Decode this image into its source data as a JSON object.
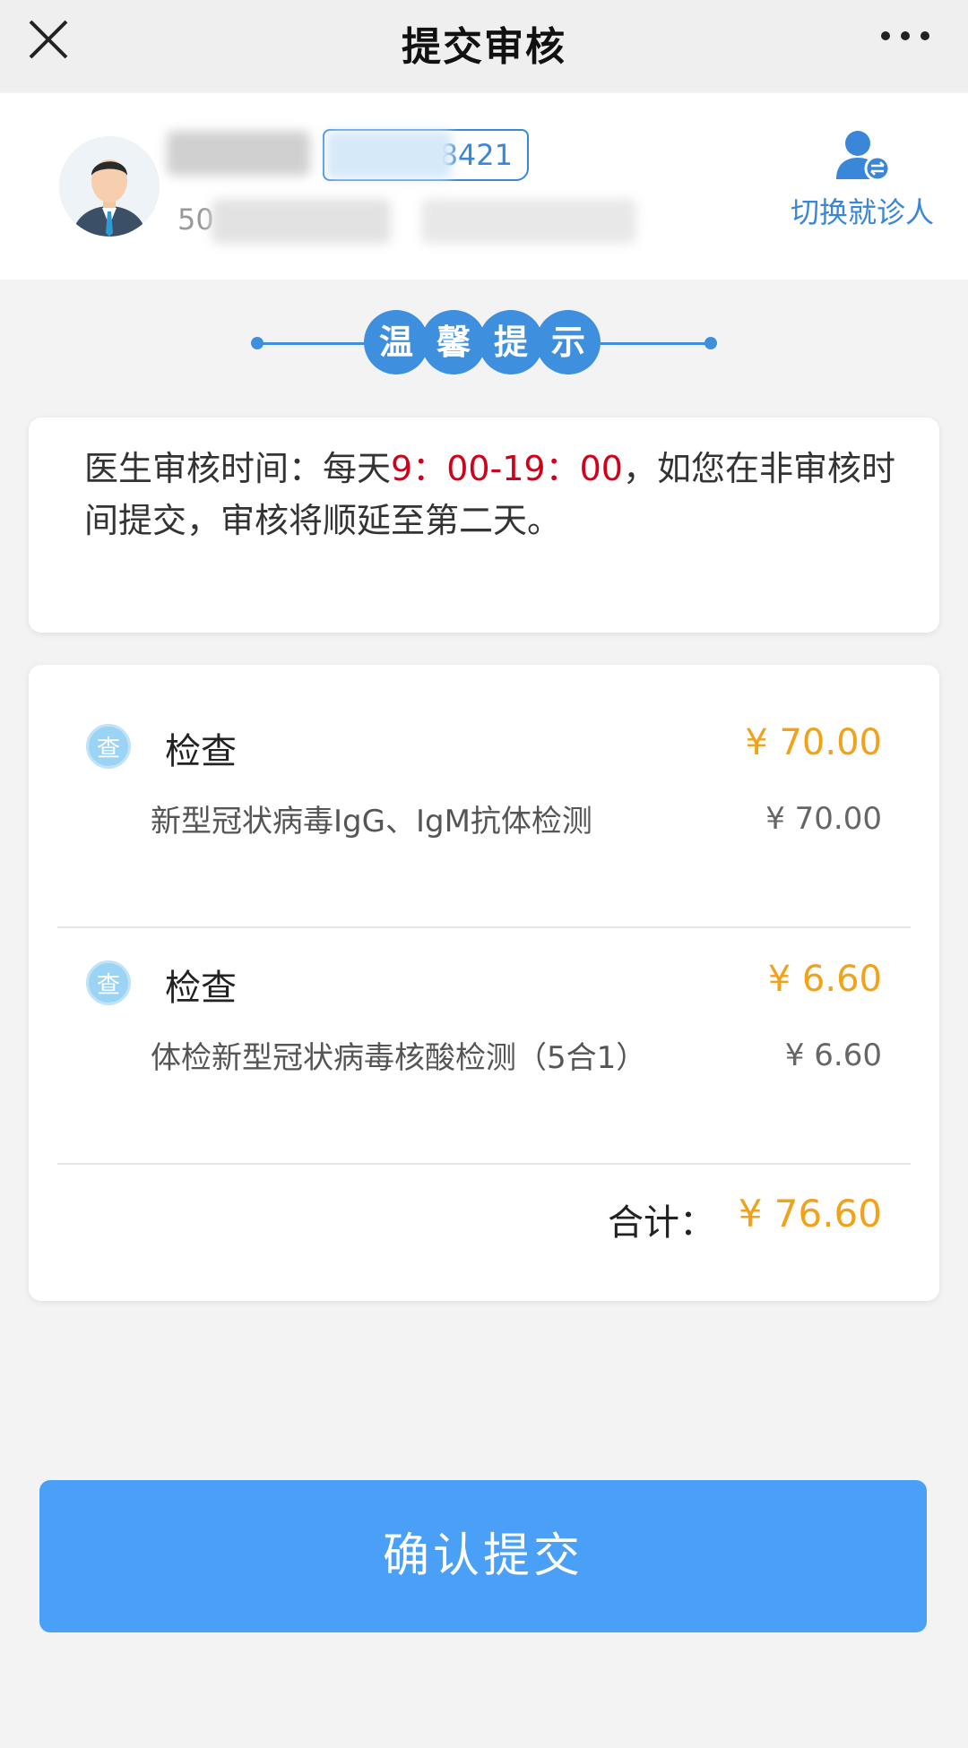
{
  "topbar": {
    "title": "提交审核",
    "close_icon": "close-icon",
    "more_icon": "more-icon"
  },
  "patient": {
    "id_suffix": "8421",
    "sub_prefix": "50",
    "switch_label": "切换就诊人",
    "switch_icon": "switch-user-icon",
    "avatar_icon": "avatar"
  },
  "tips": {
    "chars": [
      "温",
      "馨",
      "提",
      "示"
    ]
  },
  "notice": {
    "prefix": "医生审核时间：每天",
    "time": "9：00-19：00",
    "suffix": "，如您在非审核时间提交，审核将顺延至第二天。"
  },
  "items": [
    {
      "category": "检查",
      "category_icon_text": "查",
      "category_price": "¥ 70.00",
      "name": "新型冠状病毒IgG、IgM抗体检测",
      "price": "¥ 70.00"
    },
    {
      "category": "检查",
      "category_icon_text": "查",
      "category_price": "¥ 6.60",
      "name": "体检新型冠状病毒核酸检测（5合1）",
      "price": "¥ 6.60"
    }
  ],
  "total": {
    "label": "合计：",
    "value": "¥ 76.60"
  },
  "confirm_label": "确认提交",
  "colors": {
    "accent": "#4aa0f6",
    "price": "#f0a21b",
    "highlight": "#d0021b"
  }
}
